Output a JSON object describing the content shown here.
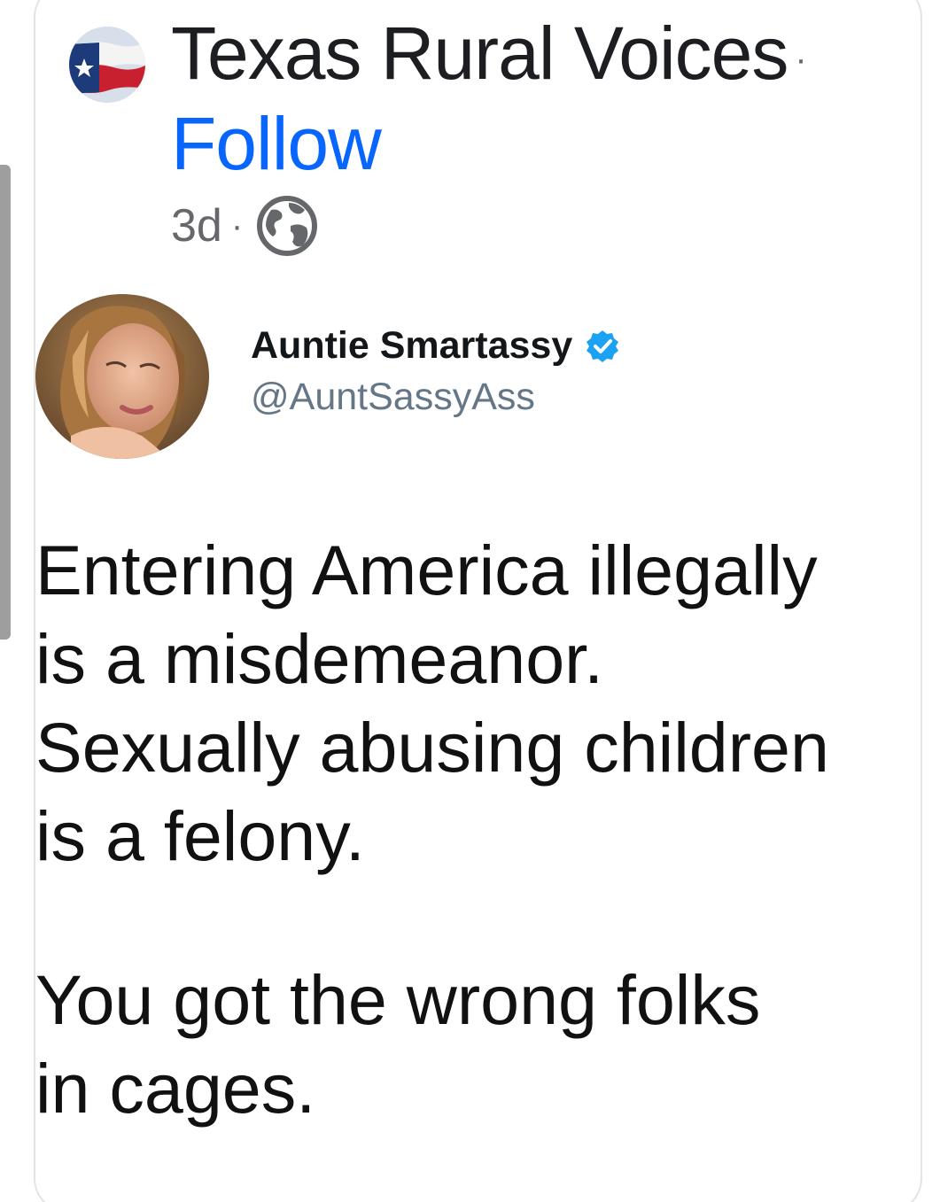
{
  "post": {
    "page_name": "Texas Rural Voices",
    "separator": "·",
    "follow_label": "Follow",
    "time_ago": "3d",
    "meta_separator": "·",
    "avatar_icon": "texas-flag-icon",
    "audience_icon": "globe-icon"
  },
  "tweet": {
    "author_name": "Auntie Smartassy",
    "handle": "@AuntSassyAss",
    "verified_icon": "verified-badge-icon",
    "verified_color": "#1da1f2",
    "paragraph1": [
      "Entering America illegally",
      "is a misdemeanor.",
      "Sexually abusing children",
      "is a felony."
    ],
    "paragraph2": [
      "You got the wrong folks",
      "in cages."
    ]
  },
  "colors": {
    "follow": "#0866ff",
    "meta_text": "#65676b",
    "primary_text": "#1c1e21"
  }
}
